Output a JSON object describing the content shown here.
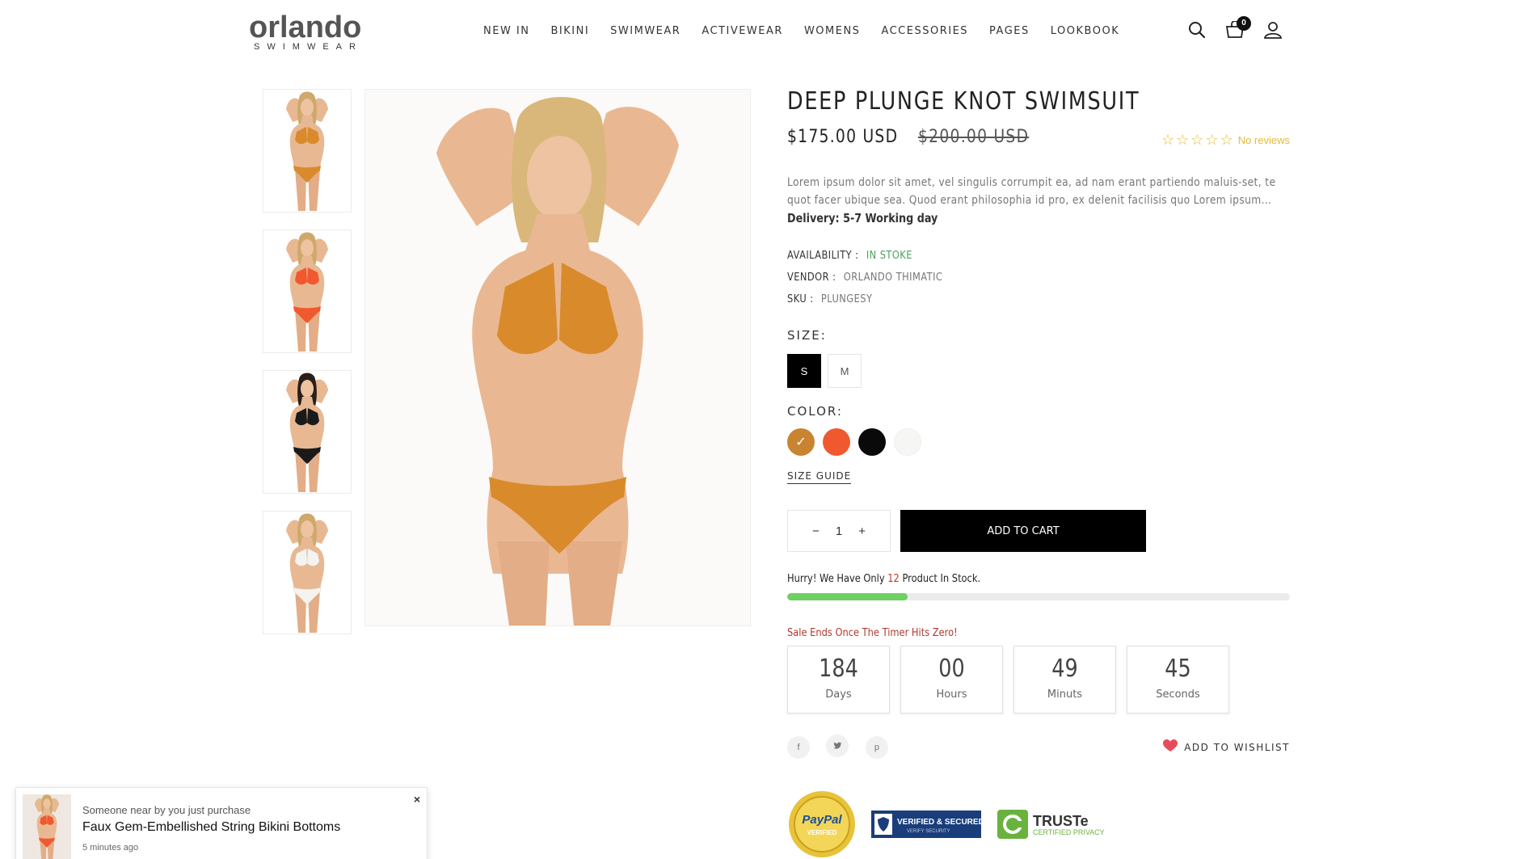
{
  "brand": {
    "name": "orlando",
    "tagline": "SWIMWEAR"
  },
  "nav": [
    "NEW IN",
    "BIKINI",
    "SWIMWEAR",
    "ACTIVEWEAR",
    "WOMENS",
    "ACCESSORIES",
    "PAGES",
    "LOOKBOOK"
  ],
  "header": {
    "cart_count": "0"
  },
  "gallery": {
    "thumbnails": [
      {
        "color": "#d98a2b"
      },
      {
        "color": "#f0592f"
      },
      {
        "color": "#1a1a1a"
      },
      {
        "color": "#f5f3ef"
      }
    ],
    "main_color": "#d98a2b"
  },
  "product": {
    "title": "DEEP PLUNGE KNOT SWIMSUIT",
    "price": "$175.00 USD",
    "compare_price": "$200.00 USD",
    "rating": 0,
    "reviews_label": "No reviews",
    "description": "Lorem ipsum dolor sit amet, vel singulis corrumpit ea, ad nam erant partiendo maluis-set, te quot facer ubique sea. Quod erant philosophia id pro, ex delenit facilisis quo Lorem ipsum...",
    "delivery": "Delivery: 5-7 Working day",
    "availability_label": "AVAILABILITY :",
    "availability_value": "IN STOKE",
    "vendor_label": "VENDOR :",
    "vendor_value": "ORLANDO THIMATIC",
    "sku_label": "SKU :",
    "sku_value": "PLUNGESY",
    "size_label": "SIZE:",
    "sizes": [
      "S",
      "M"
    ],
    "selected_size": "S",
    "color_label": "COLOR:",
    "colors": [
      "#c98431",
      "#f0592f",
      "#0a0a0a",
      "#f6f6f4"
    ],
    "size_guide": "SIZE GUIDE",
    "quantity": "1",
    "qty_minus": "−",
    "qty_plus": "+",
    "add_to_cart": "ADD TO CART",
    "stock_prefix": "Hurry! We Have Only",
    "stock_count": "12",
    "stock_suffix": "Product In Stock.",
    "stock_fraction": 0.24,
    "sale_text": "Sale Ends Once The Timer Hits Zero!",
    "timer": [
      {
        "value": "184",
        "unit": "Days"
      },
      {
        "value": "00",
        "unit": "Hours"
      },
      {
        "value": "49",
        "unit": "Minuts"
      },
      {
        "value": "45",
        "unit": "Seconds"
      }
    ],
    "social": [
      "f",
      "t",
      "p"
    ],
    "wishlist": "ADD TO WISHLIST"
  },
  "trust_badges": {
    "paypal": "PayPal",
    "paypal_sub": "VERIFIED",
    "secure": "VERIFIED & SECURED",
    "secure_sub": "VERIFY SECURITY",
    "truste": "TRUSTe",
    "truste_sub": "CERTIFIED PRIVACY"
  },
  "popup": {
    "top": "Someone near by you just purchase",
    "name": "Faux Gem-Embellished String Bikini Bottoms",
    "time": "5 minutes ago",
    "close": "×"
  }
}
